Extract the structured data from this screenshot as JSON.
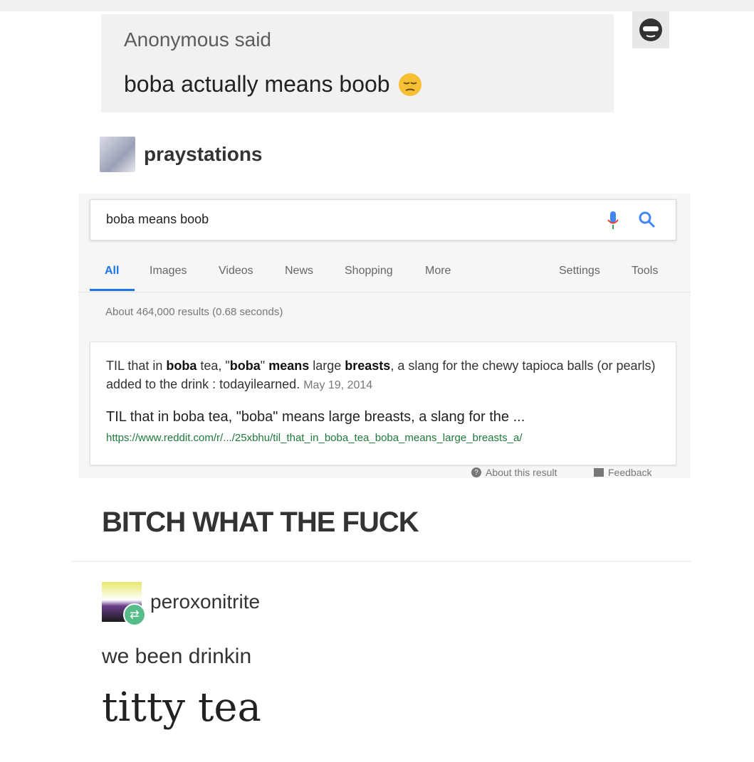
{
  "ask": {
    "who": "Anonymous said",
    "question": "boba actually means boob"
  },
  "op": {
    "username": "praystations"
  },
  "google": {
    "query": "boba means boob",
    "tabs": [
      "All",
      "Images",
      "Videos",
      "News",
      "Shopping",
      "More"
    ],
    "right_tabs": [
      "Settings",
      "Tools"
    ],
    "result_stats": "About 464,000 results (0.68 seconds)",
    "snippet": {
      "line_part1": "TIL that in ",
      "b1": "boba",
      "line_part2": " tea, \"",
      "b2": "boba",
      "line_part3": "\" ",
      "b3": "means",
      "line_part4": " large ",
      "b4": "breasts",
      "line_part5": ", a slang for the chewy tapioca balls (or pearls) added to the drink : todayilearned.",
      "date": "May 19, 2014"
    },
    "result_title": "TIL that in boba tea, \"boba\" means large breasts, a slang for the ...",
    "result_url": "https://www.reddit.com/r/.../25xbhu/til_that_in_boba_tea_boba_means_large_breasts_a/",
    "about": "About this result",
    "feedback": "Feedback"
  },
  "op_comment": "BITCH WHAT THE FUCK",
  "reblogger": {
    "username": "peroxonitrite"
  },
  "reply": {
    "line1": "we been drinkin",
    "line2": "titty tea"
  },
  "colors": {
    "tab_active": "#1a73e8",
    "url_green": "#1e7a3a",
    "reblog_green": "#56bc8a"
  }
}
